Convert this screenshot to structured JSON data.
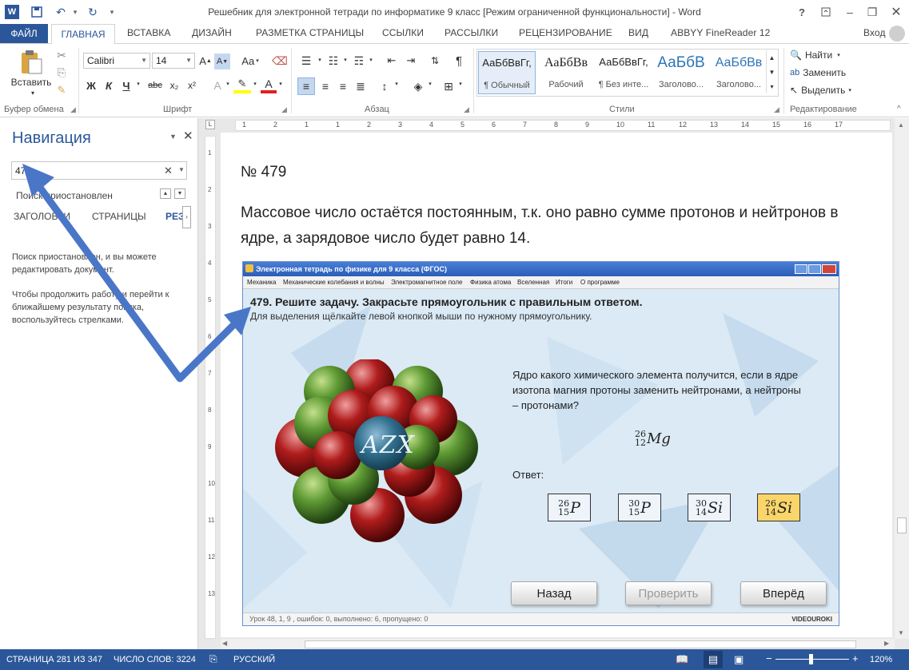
{
  "window": {
    "title": "Решебник для электронной тетради по информатике 9 класс [Режим ограниченной функциональности] - Word",
    "help": "?",
    "login": "Вход"
  },
  "tabs": [
    "ФАЙЛ",
    "ГЛАВНАЯ",
    "ВСТАВКА",
    "ДИЗАЙН",
    "РАЗМЕТКА СТРАНИЦЫ",
    "ССЫЛКИ",
    "РАССЫЛКИ",
    "РЕЦЕНЗИРОВАНИЕ",
    "ВИД",
    "ABBYY FineReader 12"
  ],
  "ribbon": {
    "clipboard": {
      "paste": "Вставить",
      "label": "Буфер обмена"
    },
    "font": {
      "name": "Calibri",
      "size": "14",
      "label": "Шрифт",
      "bold": "Ж",
      "italic": "К",
      "underline": "Ч",
      "strike": "abc",
      "sub": "x₂",
      "sup": "x²",
      "aa": "Aa"
    },
    "paragraph": {
      "label": "Абзац"
    },
    "styles": {
      "label": "Стили",
      "items": [
        {
          "sample": "АаБбВвГг,",
          "name": "¶ Обычный"
        },
        {
          "sample": "АаБбВв",
          "name": "Рабочий"
        },
        {
          "sample": "АаБбВвГг,",
          "name": "¶ Без инте..."
        },
        {
          "sample": "АаБбВ",
          "name": "Заголово..."
        },
        {
          "sample": "АаБбВв",
          "name": "Заголово..."
        }
      ]
    },
    "editing": {
      "find": "Найти",
      "replace": "Заменить",
      "select": "Выделить",
      "label": "Редактирование"
    }
  },
  "nav": {
    "title": "Навигация",
    "search_value": "479",
    "status": "Поиск приостановлен",
    "tabs": [
      "ЗАГОЛОВКИ",
      "СТРАНИЦЫ",
      "РЕЗ"
    ],
    "msg1": "Поиск приостановлен, и вы можете редактировать документ.",
    "msg2": "Чтобы продолжить работу и перейти к ближайшему результату поиска, воспользуйтесь стрелками."
  },
  "ruler_marks": [
    "1",
    "2",
    "1",
    "1",
    "2",
    "3",
    "4",
    "5",
    "6",
    "7",
    "8",
    "9",
    "10",
    "11",
    "12",
    "13",
    "14",
    "15",
    "16",
    "17"
  ],
  "doc": {
    "heading": "№ 479",
    "para": "Массовое число остаётся постоянным, т.к. оно равно сумме протонов и нейтронов в ядре, а зарядовое число будет равно 14."
  },
  "app": {
    "title": "Электронная тетрадь по физике для 9 класса (ФГОС)",
    "menu": [
      "Механика",
      "Механические колебания и волны",
      "Электромагнитное поле",
      "Физика атома",
      "Вселенная",
      "Итоги",
      "О программе"
    ],
    "task": "479. Решите задачу. Закрасьте прямоугольник с правильным ответом.",
    "hint": "Для выделения щёлкайте левой кнопкой мыши по нужному прямоугольнику.",
    "question": "Ядро какого химического элемента получится, если в ядре изотопа магния протоны заменить нейтронами, а нейтроны – протонами?",
    "isotope": {
      "mass": "26",
      "z": "12",
      "sym": "Mg"
    },
    "answer_label": "Ответ:",
    "options": [
      {
        "mass": "26",
        "z": "15",
        "sym": "P",
        "selected": false
      },
      {
        "mass": "30",
        "z": "15",
        "sym": "P",
        "selected": false
      },
      {
        "mass": "30",
        "z": "14",
        "sym": "Si",
        "selected": false
      },
      {
        "mass": "26",
        "z": "14",
        "sym": "Si",
        "selected": true
      }
    ],
    "btn_back": "Назад",
    "btn_check": "Проверить",
    "btn_next": "Вперёд",
    "status": "Урок 48, 1, 9 , ошибок: 0, выполнено: 6, пропущено: 0",
    "logo": "VIDEOUROKI",
    "atom_label": "AZX"
  },
  "statusbar": {
    "page": "СТРАНИЦА 281 ИЗ 347",
    "words": "ЧИСЛО СЛОВ: 3224",
    "lang": "РУССКИЙ",
    "zoom": "120%",
    "zoom_minus": "−",
    "zoom_plus": "+"
  },
  "colors": {
    "accent": "#2b579a",
    "selected_answer": "#f9d56a",
    "arrow": "#4a76c8"
  }
}
